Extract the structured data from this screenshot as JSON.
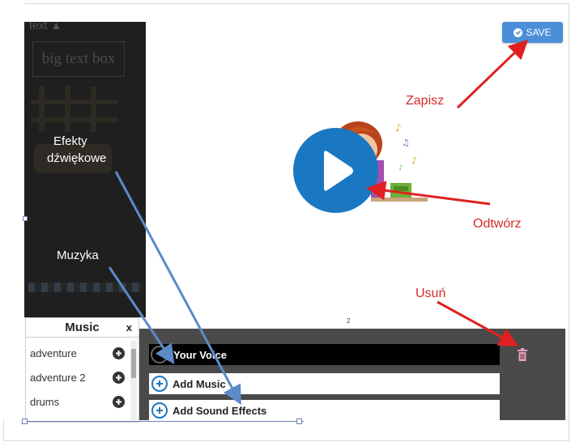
{
  "toolbar": {
    "save_label": "SAVE"
  },
  "sidebar": {
    "header_label": "text",
    "text_box_label": "big text box"
  },
  "canvas": {
    "page_number": "2"
  },
  "music_panel": {
    "title": "Music",
    "close_label": "x",
    "items": [
      {
        "label": "adventure"
      },
      {
        "label": "adventure 2"
      },
      {
        "label": "drums"
      }
    ]
  },
  "audio_panel": {
    "voice_label": "Your Voice",
    "music_label": "Add Music",
    "sfx_label": "Add Sound Effects"
  },
  "annotations": {
    "save": "Zapisz",
    "play": "Odtwórz",
    "delete": "Usuń",
    "sound_effects_line1": "Efekty",
    "sound_effects_line2": "dźwiękowe",
    "music": "Muzyka"
  },
  "colors": {
    "accent_blue": "#1a78c2",
    "save_blue": "#4a8fd8",
    "annotation_red": "#e02020",
    "annotation_arrow_blue": "#5b8bc6",
    "sidebar_dark": "#1f1f1f",
    "audio_panel_gray": "#4a4a4a"
  },
  "icons": {
    "save": "check-circle-icon",
    "play": "play-icon",
    "add": "plus-circle-icon",
    "delete": "trash-icon",
    "voice": "record-ring-icon"
  }
}
